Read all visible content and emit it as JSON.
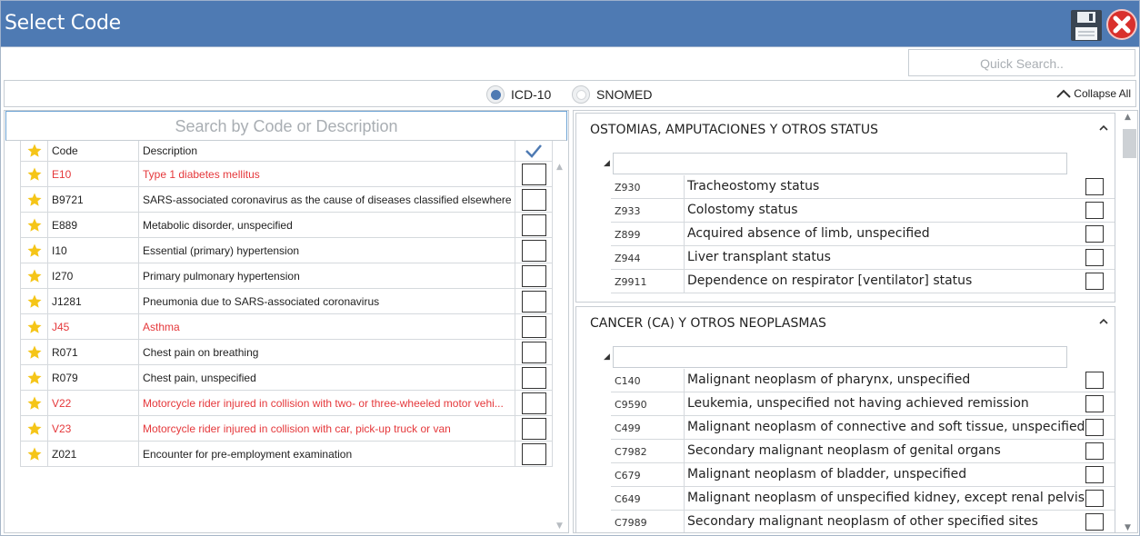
{
  "window": {
    "title": "Select Code"
  },
  "toolbar": {
    "save_icon": "floppy-disk-icon",
    "close_icon": "close-x-icon"
  },
  "quick_search": {
    "placeholder": "Quick Search.."
  },
  "code_system": {
    "options": [
      "ICD-10",
      "SNOMED"
    ],
    "selected": "ICD-10",
    "collapse_all": "Collapse All"
  },
  "favorites": {
    "search_placeholder": "Search by Code or Description",
    "columns": {
      "code": "Code",
      "description": "Description"
    },
    "rows": [
      {
        "code": "E10",
        "description": "Type 1 diabetes mellitus",
        "highlight": true
      },
      {
        "code": "B9721",
        "description": "SARS-associated coronavirus as the cause of diseases classified elsewhere",
        "highlight": false
      },
      {
        "code": "E889",
        "description": "Metabolic disorder, unspecified",
        "highlight": false
      },
      {
        "code": "I10",
        "description": "Essential (primary) hypertension",
        "highlight": false
      },
      {
        "code": "I270",
        "description": "Primary pulmonary hypertension",
        "highlight": false
      },
      {
        "code": "J1281",
        "description": "Pneumonia due to SARS-associated coronavirus",
        "highlight": false
      },
      {
        "code": "J45",
        "description": "Asthma",
        "highlight": true
      },
      {
        "code": "R071",
        "description": "Chest pain on breathing",
        "highlight": false
      },
      {
        "code": "R079",
        "description": "Chest pain, unspecified",
        "highlight": false
      },
      {
        "code": "V22",
        "description": "Motorcycle rider injured in collision with two- or three-wheeled motor vehi...",
        "highlight": true
      },
      {
        "code": "V23",
        "description": "Motorcycle rider injured in collision with car, pick-up truck or van",
        "highlight": true
      },
      {
        "code": "Z021",
        "description": "Encounter for pre-employment examination",
        "highlight": false
      }
    ]
  },
  "groups": [
    {
      "title": "OSTOMIAS, AMPUTACIONES Y OTROS STATUS",
      "rows": [
        {
          "code": "Z930",
          "description": "Tracheostomy status"
        },
        {
          "code": "Z933",
          "description": "Colostomy status"
        },
        {
          "code": "Z899",
          "description": "Acquired absence of limb, unspecified"
        },
        {
          "code": "Z944",
          "description": "Liver transplant status"
        },
        {
          "code": "Z9911",
          "description": "Dependence on respirator [ventilator] status"
        }
      ]
    },
    {
      "title": "CANCER (CA) Y OTROS NEOPLASMAS",
      "rows": [
        {
          "code": "C140",
          "description": "Malignant neoplasm of pharynx, unspecified"
        },
        {
          "code": "C9590",
          "description": "Leukemia, unspecified not having achieved remission"
        },
        {
          "code": "C499",
          "description": "Malignant neoplasm of connective and soft tissue, unspecified"
        },
        {
          "code": "C7982",
          "description": "Secondary malignant neoplasm of genital organs"
        },
        {
          "code": "C679",
          "description": "Malignant neoplasm of bladder, unspecified"
        },
        {
          "code": "C649",
          "description": "Malignant neoplasm of unspecified kidney, except renal pelvis"
        },
        {
          "code": "C7989",
          "description": "Secondary malignant neoplasm of other specified sites"
        }
      ]
    }
  ],
  "colors": {
    "titlebar": "#4e7ab3",
    "highlight_text": "#e5383b",
    "star": "#f5c518",
    "accent": "#4e7ab3"
  }
}
